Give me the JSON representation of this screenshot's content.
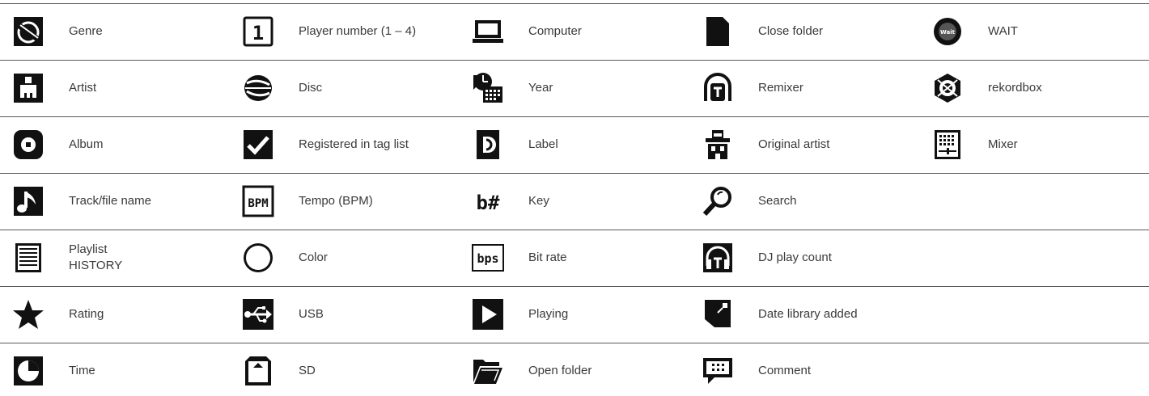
{
  "items": [
    [
      {
        "icon": "genre-icon",
        "label": "Genre"
      },
      {
        "icon": "player-number-icon",
        "label": "Player number (1 – 4)"
      },
      {
        "icon": "computer-icon",
        "label": "Computer"
      },
      {
        "icon": "close-folder-icon",
        "label": "Close folder"
      },
      {
        "icon": "wait-icon",
        "label": "WAIT"
      }
    ],
    [
      {
        "icon": "artist-icon",
        "label": "Artist"
      },
      {
        "icon": "disc-icon",
        "label": "Disc"
      },
      {
        "icon": "year-icon",
        "label": "Year"
      },
      {
        "icon": "remixer-icon",
        "label": "Remixer"
      },
      {
        "icon": "rekordbox-icon",
        "label": "rekordbox"
      }
    ],
    [
      {
        "icon": "album-icon",
        "label": "Album"
      },
      {
        "icon": "checkmark-icon",
        "label": "Registered in tag list"
      },
      {
        "icon": "label-icon",
        "label": "Label"
      },
      {
        "icon": "original-artist-icon",
        "label": "Original artist"
      },
      {
        "icon": "mixer-icon",
        "label": "Mixer"
      }
    ],
    [
      {
        "icon": "music-note-icon",
        "label": "Track/file name"
      },
      {
        "icon": "bpm-icon",
        "label": "Tempo (BPM)"
      },
      {
        "icon": "key-icon",
        "label": "Key"
      },
      {
        "icon": "search-icon",
        "label": "Search"
      },
      null
    ],
    [
      {
        "icon": "playlist-icon",
        "label": "Playlist\nHISTORY"
      },
      {
        "icon": "color-icon",
        "label": "Color"
      },
      {
        "icon": "bit-rate-icon",
        "label": "Bit rate"
      },
      {
        "icon": "headphones-icon",
        "label": "DJ play count"
      },
      null
    ],
    [
      {
        "icon": "star-icon",
        "label": "Rating"
      },
      {
        "icon": "usb-icon",
        "label": "USB"
      },
      {
        "icon": "play-icon",
        "label": "Playing"
      },
      {
        "icon": "date-added-icon",
        "label": "Date library added"
      },
      null
    ],
    [
      {
        "icon": "clock-icon",
        "label": "Time"
      },
      {
        "icon": "sd-card-icon",
        "label": "SD"
      },
      {
        "icon": "open-folder-icon",
        "label": "Open folder"
      },
      {
        "icon": "comment-icon",
        "label": "Comment"
      },
      null
    ]
  ],
  "icon_glyph_text": {
    "wait": "Wait",
    "player_number": "1",
    "bpm": "BPM",
    "key": "b#",
    "bit_rate": "bps"
  },
  "colors": {
    "text": "#3a3a3a",
    "icon_fill": "#111111",
    "rule": "#5a5a5a"
  }
}
